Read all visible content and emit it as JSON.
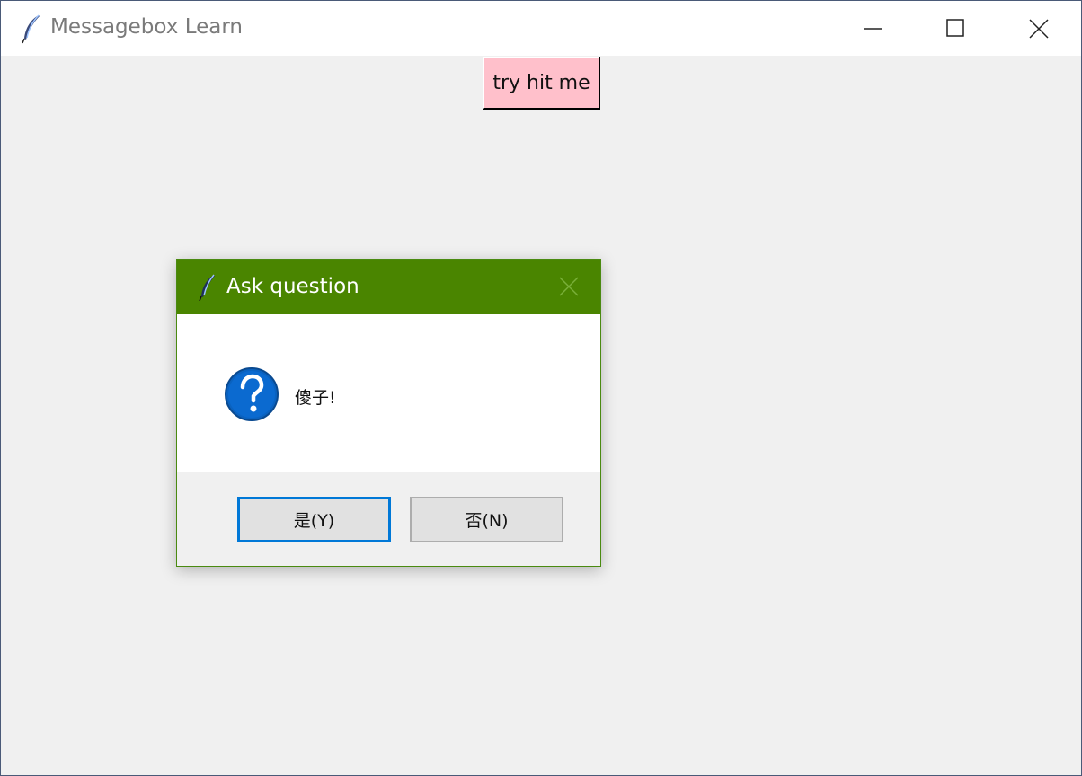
{
  "window": {
    "title": "Messagebox Learn"
  },
  "main": {
    "hit_button_label": "try hit me",
    "hit_button_color": "#ffc0cb"
  },
  "dialog": {
    "title": "Ask question",
    "message": "傻子!",
    "titlebar_color": "#4a8500",
    "buttons": {
      "yes_label": "是(Y)",
      "no_label": "否(N)"
    }
  },
  "icons": {
    "app": "feather-icon",
    "minimize": "minimize-icon",
    "maximize": "maximize-icon",
    "close": "close-icon",
    "question": "question-icon"
  }
}
